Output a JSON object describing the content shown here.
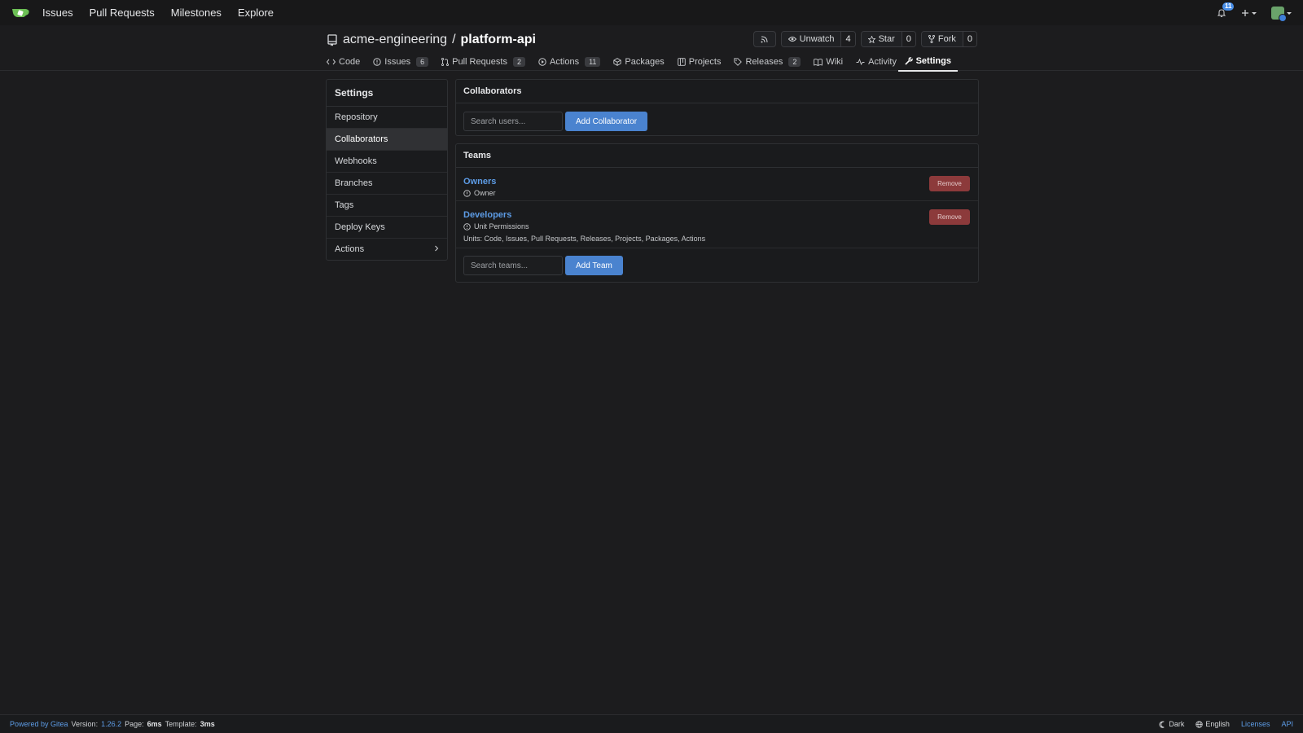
{
  "navbar": {
    "links": [
      "Issues",
      "Pull Requests",
      "Milestones",
      "Explore"
    ],
    "notification_count": "11"
  },
  "repo": {
    "owner": "acme-engineering",
    "separator": "/",
    "name": "platform-api",
    "watch": {
      "label": "Unwatch",
      "count": "4"
    },
    "star": {
      "label": "Star",
      "count": "0"
    },
    "fork": {
      "label": "Fork",
      "count": "0"
    }
  },
  "tabs": [
    {
      "label": "Code",
      "icon": "code-icon"
    },
    {
      "label": "Issues",
      "count": "6",
      "icon": "issue-icon"
    },
    {
      "label": "Pull Requests",
      "count": "2",
      "icon": "pull-request-icon"
    },
    {
      "label": "Actions",
      "count": "11",
      "icon": "actions-icon"
    },
    {
      "label": "Packages",
      "icon": "package-icon"
    },
    {
      "label": "Projects",
      "icon": "project-icon"
    },
    {
      "label": "Releases",
      "count": "2",
      "icon": "tag-icon"
    },
    {
      "label": "Wiki",
      "icon": "book-icon"
    },
    {
      "label": "Activity",
      "icon": "pulse-icon"
    },
    {
      "label": "Settings",
      "icon": "tool-icon",
      "active": true
    }
  ],
  "sidebar": {
    "title": "Settings",
    "items": [
      {
        "label": "Repository"
      },
      {
        "label": "Collaborators",
        "active": true
      },
      {
        "label": "Webhooks"
      },
      {
        "label": "Branches"
      },
      {
        "label": "Tags"
      },
      {
        "label": "Deploy Keys"
      },
      {
        "label": "Actions",
        "has_submenu": true
      }
    ]
  },
  "collaborators": {
    "title": "Collaborators",
    "search_placeholder": "Search users...",
    "add_button": "Add Collaborator"
  },
  "teams": {
    "title": "Teams",
    "list": [
      {
        "name": "Owners",
        "permission": "Owner",
        "remove_label": "Remove"
      },
      {
        "name": "Developers",
        "permission": "Unit Permissions",
        "units": "Units: Code, Issues, Pull Requests, Releases, Projects, Packages, Actions",
        "remove_label": "Remove"
      }
    ],
    "search_placeholder": "Search teams...",
    "add_button": "Add Team"
  },
  "footer": {
    "powered_by": "Powered by Gitea",
    "version_label": "Version:",
    "version": "1.26.2",
    "page_label": "Page:",
    "page_time": "6ms",
    "template_label": "Template:",
    "template_time": "3ms",
    "theme": "Dark",
    "language": "English",
    "licenses": "Licenses",
    "api": "API"
  },
  "colors": {
    "background": "#1c1c1e",
    "accent": "#4a83cf",
    "link": "#5d9ce6",
    "danger": "#8c3a3b"
  }
}
